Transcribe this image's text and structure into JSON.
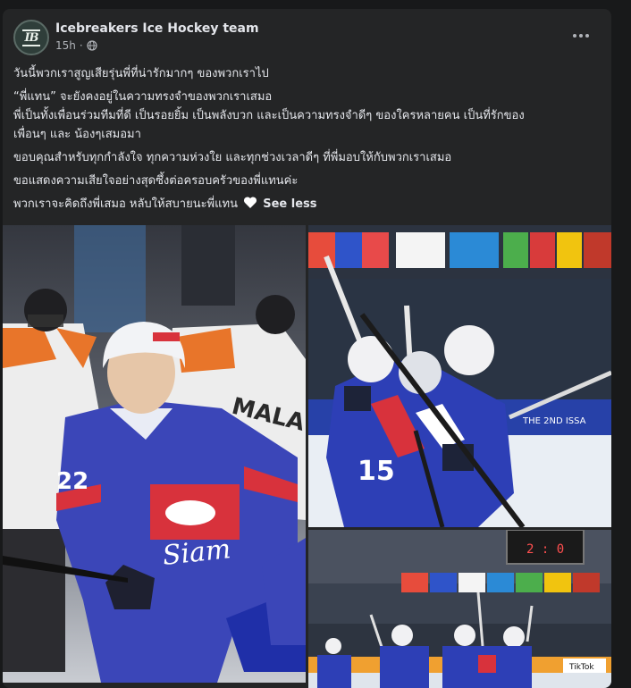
{
  "post": {
    "page_name": "Icebreakers Ice Hockey team",
    "timestamp": "15h",
    "separator": "·",
    "audience_icon": "globe-icon",
    "avatar_text": "IB",
    "more_icon": "more-dots-icon",
    "caption": {
      "p1": "วันนี้พวกเราสูญเสียรุ่นพี่ที่น่ารักมากๆ ของพวกเราไป",
      "p2_line1": "“พี่แทน” จะยังคงอยู่ในความทรงจำของพวกเราเสมอ",
      "p2_line2": "พี่เป็นทั้งเพื่อนร่วมทีมที่ดี เป็นรอยยิ้ม เป็นพลังบวก และเป็นความทรงจำดีๆ ของใครหลายคน เป็นที่รักของ",
      "p2_line3": "เพื่อนๆ และ น้องๆเสมอมา",
      "p3": "ขอบคุณสำหรับทุกกำลังใจ ทุกความห่วงใย และทุกช่วงเวลาดีๆ ที่พี่มอบให้กับพวกเราเสมอ",
      "p4": "ขอแสดงความเสียใจอย่างสุดซึ้งต่อครอบครัวของพี่แทนค่ะ",
      "p5": "พวกเราจะคิดถึงพี่เสมอ หลับให้สบายนะพี่แทน",
      "heart_icon": "white-heart-icon",
      "see_less": "See less"
    },
    "photos": {
      "left": {
        "jersey_number": "22",
        "jersey_text": "Siam",
        "opponent_text": "MALA",
        "colors": {
          "home": "#3b46b8",
          "home_trim": "#d8323c",
          "opponent": "#f2f2f2",
          "opponent_trim": "#e8752a"
        }
      },
      "top_right": {
        "jersey_number": "15",
        "banner_text": "THE 2ND ISSA",
        "colors": {
          "home": "#2d3fb6",
          "ice": "#e9eef4",
          "board": "#2741a8"
        }
      },
      "bottom_right": {
        "scoreboard": "2 : 0",
        "ad_text": "TikTok",
        "colors": {
          "home": "#2d3fb6"
        }
      }
    }
  }
}
